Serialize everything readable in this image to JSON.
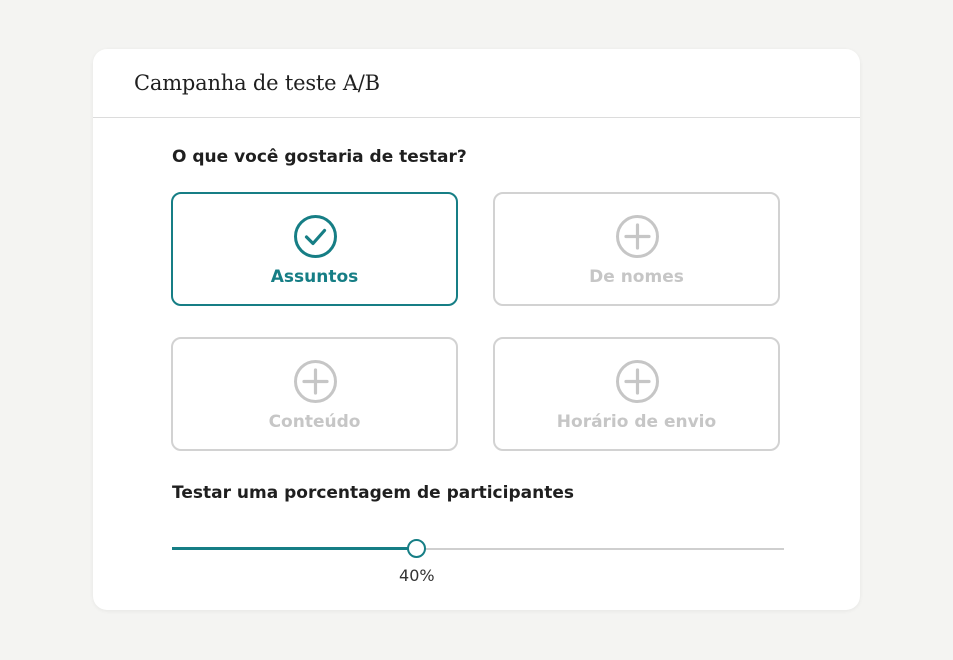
{
  "header": {
    "title": "Campanha de teste A/B"
  },
  "question": {
    "label": "O que você gostaria de testar?"
  },
  "options": [
    {
      "label": "Assuntos",
      "icon": "check-circle-icon",
      "selected": true
    },
    {
      "label": "De nomes",
      "icon": "plus-circle-icon",
      "selected": false
    },
    {
      "label": "Conteúdo",
      "icon": "plus-circle-icon",
      "selected": false
    },
    {
      "label": "Horário de envio",
      "icon": "plus-circle-icon",
      "selected": false
    }
  ],
  "percentage": {
    "label": "Testar uma porcentagem de participantes",
    "value": 40,
    "value_text": "40%"
  },
  "colors": {
    "accent": "#167e85",
    "inactive": "#c6c6c6",
    "background": "#f4f4f2"
  }
}
